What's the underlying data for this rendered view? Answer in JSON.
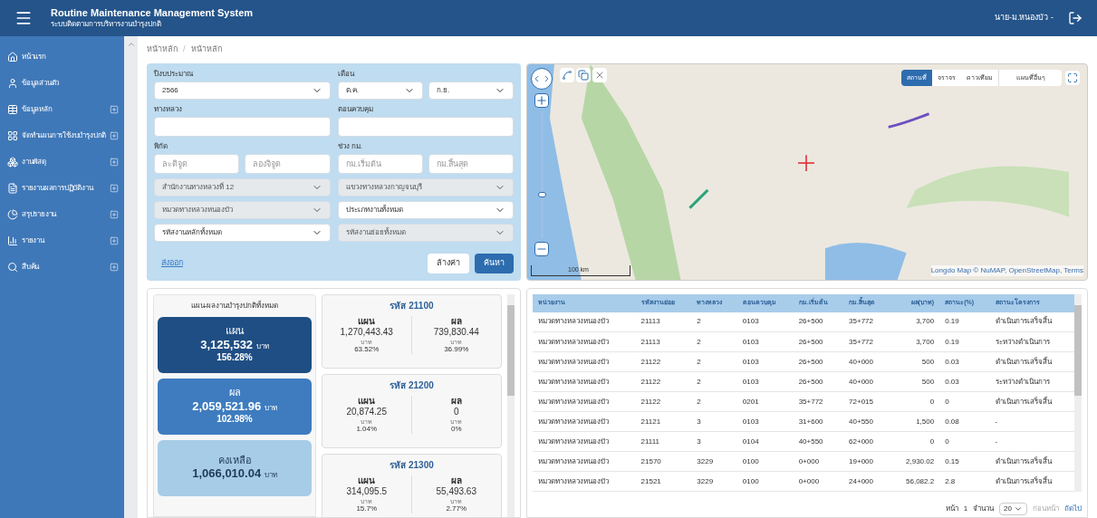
{
  "header": {
    "title": "Routine Maintenance Management System",
    "subtitle": "ระบบติดตามการบริหารงานบำรุงปกติ",
    "user": "นาย-ม.หนองบัว -"
  },
  "sidebar": {
    "items": [
      {
        "label": "หน้าแรก",
        "expandable": false
      },
      {
        "label": "ข้อมูลส่วนตัว",
        "expandable": false
      },
      {
        "label": "ข้อมูลหลัก",
        "expandable": true
      },
      {
        "label": "จัดทำแผนการใช้งบบำรุงปกติ",
        "expandable": true
      },
      {
        "label": "งานพัสดุ",
        "expandable": true
      },
      {
        "label": "รายงานผลการปฏิบัติงาน",
        "expandable": true
      },
      {
        "label": "สรุปรายงาน",
        "expandable": true
      },
      {
        "label": "รายงาน",
        "expandable": true
      },
      {
        "label": "สืบค้น",
        "expandable": true
      }
    ]
  },
  "breadcrumb": {
    "items": [
      "หน้าหลัก",
      "หน้าหลัก"
    ],
    "separator": "/"
  },
  "filters": {
    "rows": [
      {
        "fields": [
          {
            "label": "ปีงบประมาณ",
            "controls": [
              {
                "kind": "select",
                "value": "2566",
                "disabled": false
              }
            ]
          },
          {
            "label": "เดือน",
            "controls": [
              {
                "kind": "select",
                "value": "ต.ค.",
                "disabled": false
              },
              {
                "kind": "select",
                "value": "ก.ย.",
                "disabled": false
              }
            ]
          }
        ]
      },
      {
        "fields": [
          {
            "label": "ทางหลวง",
            "controls": [
              {
                "kind": "input"
              }
            ]
          },
          {
            "label": "ตอนควบคุม",
            "controls": [
              {
                "kind": "input"
              }
            ]
          }
        ]
      },
      {
        "fields": [
          {
            "label": "พิกัด",
            "controls": [
              {
                "kind": "input",
                "placeholder": "ละติจูด"
              },
              {
                "kind": "input",
                "placeholder": "ลองจิจูด"
              }
            ]
          },
          {
            "label": "ช่วง กม.",
            "controls": [
              {
                "kind": "input",
                "placeholder": "กม.เริ่มต้น"
              },
              {
                "kind": "input",
                "placeholder": "กม.สิ้นสุด"
              }
            ]
          }
        ]
      },
      {
        "fields": [
          {
            "controls": [
              {
                "kind": "select",
                "value": "สำนักงานทางหลวงที่ 12",
                "disabled": true
              }
            ]
          },
          {
            "controls": [
              {
                "kind": "select",
                "value": "แขวงทางหลวงกาญจนบุรี",
                "disabled": true
              }
            ]
          }
        ]
      },
      {
        "fields": [
          {
            "controls": [
              {
                "kind": "select",
                "value": "หมวดทางหลวงหนองบัว",
                "disabled": true
              }
            ]
          },
          {
            "controls": [
              {
                "kind": "select",
                "value": "ประเภทงานทั้งหมด",
                "disabled": false
              }
            ]
          }
        ]
      },
      {
        "fields": [
          {
            "controls": [
              {
                "kind": "select",
                "value": "รหัสงานหลักทั้งหมด",
                "disabled": false
              }
            ]
          },
          {
            "controls": [
              {
                "kind": "select",
                "value": "รหัสงานย่อยทั้งหมด",
                "disabled": true
              }
            ]
          }
        ]
      }
    ],
    "export_link": "ส่งออก",
    "clear_button": "ล้างค่า",
    "search_button": "ค้นหา"
  },
  "map": {
    "types": [
      {
        "label": "สถานที่",
        "selected": true
      },
      {
        "label": "จราจร",
        "selected": false
      },
      {
        "label": "ดาวเทียม",
        "selected": false
      }
    ],
    "other_maps": "แผนที่อื่นๆ",
    "scale": "100 km",
    "zoom": {
      "level": 0.34
    },
    "attribution": "Longdo Map © NuMAP, OpenStreetMap, Terms"
  },
  "summary": {
    "title": "แผน-ผลงานบำรุงปกติทั้งหมด",
    "cards": [
      {
        "kind": "dark",
        "label": "แผน",
        "amount": "3,125,532",
        "unit": "บาท",
        "percent": "156.28%"
      },
      {
        "kind": "medium",
        "label": "ผล",
        "amount": "2,059,521.96",
        "unit": "บาท",
        "percent": "102.98%"
      },
      {
        "kind": "light",
        "label": "คงเหลือ",
        "amount": "1,066,010.04",
        "unit": "บาท"
      }
    ],
    "codes": [
      {
        "title": "รหัส 21100",
        "plan": {
          "label": "แผน",
          "amount": "1,270,443.43",
          "unit": "บาท",
          "percent": "63.52%"
        },
        "result": {
          "label": "ผล",
          "amount": "739,830.44",
          "unit": "บาท",
          "percent": "36.99%"
        }
      },
      {
        "title": "รหัส 21200",
        "plan": {
          "label": "แผน",
          "amount": "20,874.25",
          "unit": "บาท",
          "percent": "1.04%"
        },
        "result": {
          "label": "ผล",
          "amount": "0",
          "unit": "บาท",
          "percent": "0%"
        }
      },
      {
        "title": "รหัส 21300",
        "plan": {
          "label": "แผน",
          "amount": "314,095.5",
          "unit": "บาท",
          "percent": "15.7%"
        },
        "result": {
          "label": "ผล",
          "amount": "55,493.63",
          "unit": "บาท",
          "percent": "2.77%"
        }
      }
    ]
  },
  "table": {
    "columns": [
      "หน่วยงาน",
      "รหัสงานย่อย",
      "ทางหลวง",
      "ตอนควบคุม",
      "กม.เริ่มต้น",
      "กม.สิ้นสุด",
      "ผล(บาท)",
      "สถานะ(%)",
      "สถานะโครงการ"
    ],
    "rows": [
      [
        "หมวดทางหลวงหนองบัว",
        "21113",
        "2",
        "0103",
        "26+500",
        "35+772",
        "3,700",
        "0.19",
        "ดำเนินการเสร็จสิ้น"
      ],
      [
        "หมวดทางหลวงหนองบัว",
        "21113",
        "2",
        "0103",
        "26+500",
        "35+772",
        "3,700",
        "0.19",
        "ระหว่างดำเนินการ"
      ],
      [
        "หมวดทางหลวงหนองบัว",
        "21122",
        "2",
        "0103",
        "26+500",
        "40+000",
        "500",
        "0.03",
        "ดำเนินการเสร็จสิ้น"
      ],
      [
        "หมวดทางหลวงหนองบัว",
        "21122",
        "2",
        "0103",
        "26+500",
        "40+000",
        "500",
        "0.03",
        "ระหว่างดำเนินการ"
      ],
      [
        "หมวดทางหลวงหนองบัว",
        "21122",
        "2",
        "0201",
        "35+772",
        "72+015",
        "0",
        "0",
        "ดำเนินการเสร็จสิ้น"
      ],
      [
        "หมวดทางหลวงหนองบัว",
        "21121",
        "3",
        "0103",
        "31+600",
        "40+550",
        "1,500",
        "0.08",
        "-"
      ],
      [
        "หมวดทางหลวงหนองบัว",
        "21111",
        "3",
        "0104",
        "40+550",
        "62+000",
        "0",
        "0",
        "-"
      ],
      [
        "หมวดทางหลวงหนองบัว",
        "21570",
        "3229",
        "0100",
        "0+000",
        "19+000",
        "2,930.02",
        "0.15",
        "ดำเนินการเสร็จสิ้น"
      ],
      [
        "หมวดทางหลวงหนองบัว",
        "21521",
        "3229",
        "0100",
        "0+000",
        "24+000",
        "56,082.2",
        "2.8",
        "ดำเนินการเสร็จสิ้น"
      ]
    ]
  },
  "pagination": {
    "page_label": "หน้า",
    "page": "1",
    "count_label": "จำนวน",
    "page_size": "20",
    "prev": {
      "label": "ก่อนหน้า",
      "disabled": true
    },
    "next": {
      "label": "ถัดไป",
      "disabled": false
    }
  }
}
